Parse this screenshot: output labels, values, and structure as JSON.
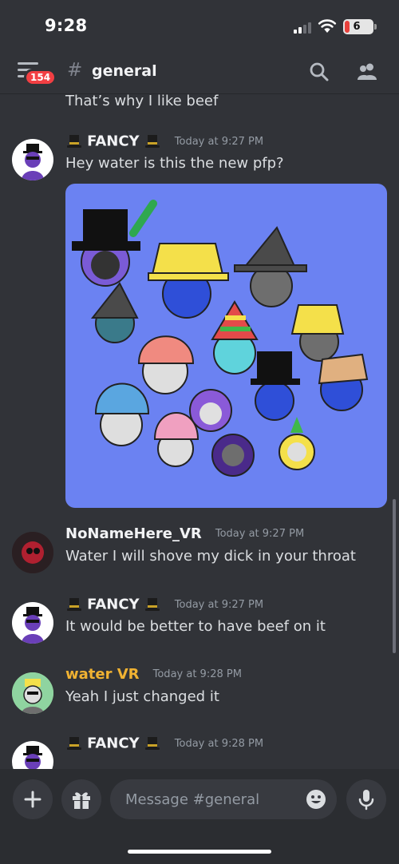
{
  "status_bar": {
    "time": "9:28",
    "battery": "6"
  },
  "header": {
    "unread_badge": "154",
    "hash": "#",
    "channel": "general"
  },
  "continuation": {
    "text": "That’s why I like beef"
  },
  "messages": [
    {
      "author": "FANCY",
      "time": "Today at 9:27 PM",
      "text": "Hey water is this the new pfp?"
    },
    {
      "author": "NoNameHere_VR",
      "time": "Today at 9:27 PM",
      "text": "Water I will shove my dick in your throat"
    },
    {
      "author": "FANCY",
      "time": "Today at 9:27 PM",
      "text": "It would be better to have beef on it"
    },
    {
      "author": "water VR",
      "time": "Today at 9:28 PM",
      "text": "Yeah I just changed it"
    },
    {
      "author": "FANCY",
      "time": "Today at 9:28 PM",
      "text": ""
    }
  ],
  "composer": {
    "placeholder": "Message #general"
  },
  "colors": {
    "background": "#313338",
    "accent_name_gold": "#f0b232",
    "badge": "#f23f43",
    "attachment_bg": "#6b82f2"
  },
  "icons": [
    "menu-icon",
    "search-icon",
    "members-icon",
    "plus-icon",
    "gift-icon",
    "emoji-icon",
    "microphone-icon",
    "top-hat-icon"
  ]
}
